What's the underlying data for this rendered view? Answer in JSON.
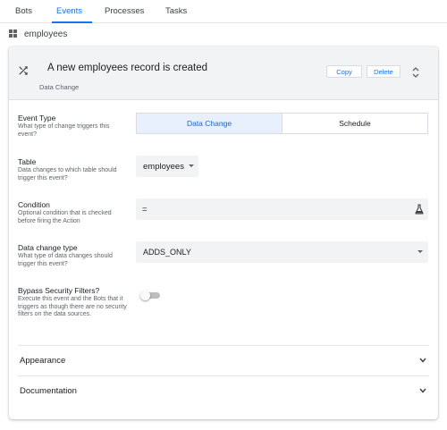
{
  "tabs": [
    {
      "label": "Bots",
      "active": false
    },
    {
      "label": "Events",
      "active": true
    },
    {
      "label": "Processes",
      "active": false
    },
    {
      "label": "Tasks",
      "active": false
    }
  ],
  "breadcrumb": {
    "icon": "table-grid-icon",
    "label": "employees"
  },
  "event": {
    "icon": "shuffle-icon",
    "title": "A new employees record is created",
    "subtitle": "Data Change",
    "copy_label": "Copy",
    "delete_label": "Delete",
    "sort_icon": "sort-arrows-icon"
  },
  "fields": {
    "event_type": {
      "label": "Event Type",
      "help": "What type of change triggers this event?",
      "options": [
        {
          "label": "Data Change",
          "selected": true
        },
        {
          "label": "Schedule",
          "selected": false
        }
      ]
    },
    "table": {
      "label": "Table",
      "help": "Data changes to which table should trigger this event?",
      "value": "employees"
    },
    "condition": {
      "label": "Condition",
      "help": "Optional condition that is checked before firing the Action",
      "value": "=",
      "icon": "flask-icon"
    },
    "data_change_type": {
      "label": "Data change type",
      "help": "What type of data changes should trigger this event?",
      "value": "ADDS_ONLY"
    },
    "bypass": {
      "label": "Bypass Security Filters?",
      "help": "Execute this event and the Bots that it triggers as though there are no security filters on the data sources.",
      "enabled": false
    }
  },
  "sections": [
    {
      "label": "Appearance"
    },
    {
      "label": "Documentation"
    }
  ],
  "colors": {
    "accent": "#1a73e8",
    "selected_bg": "#e8f0fe",
    "field_bg": "#f1f3f4",
    "header_bg": "#f1f3f4"
  }
}
